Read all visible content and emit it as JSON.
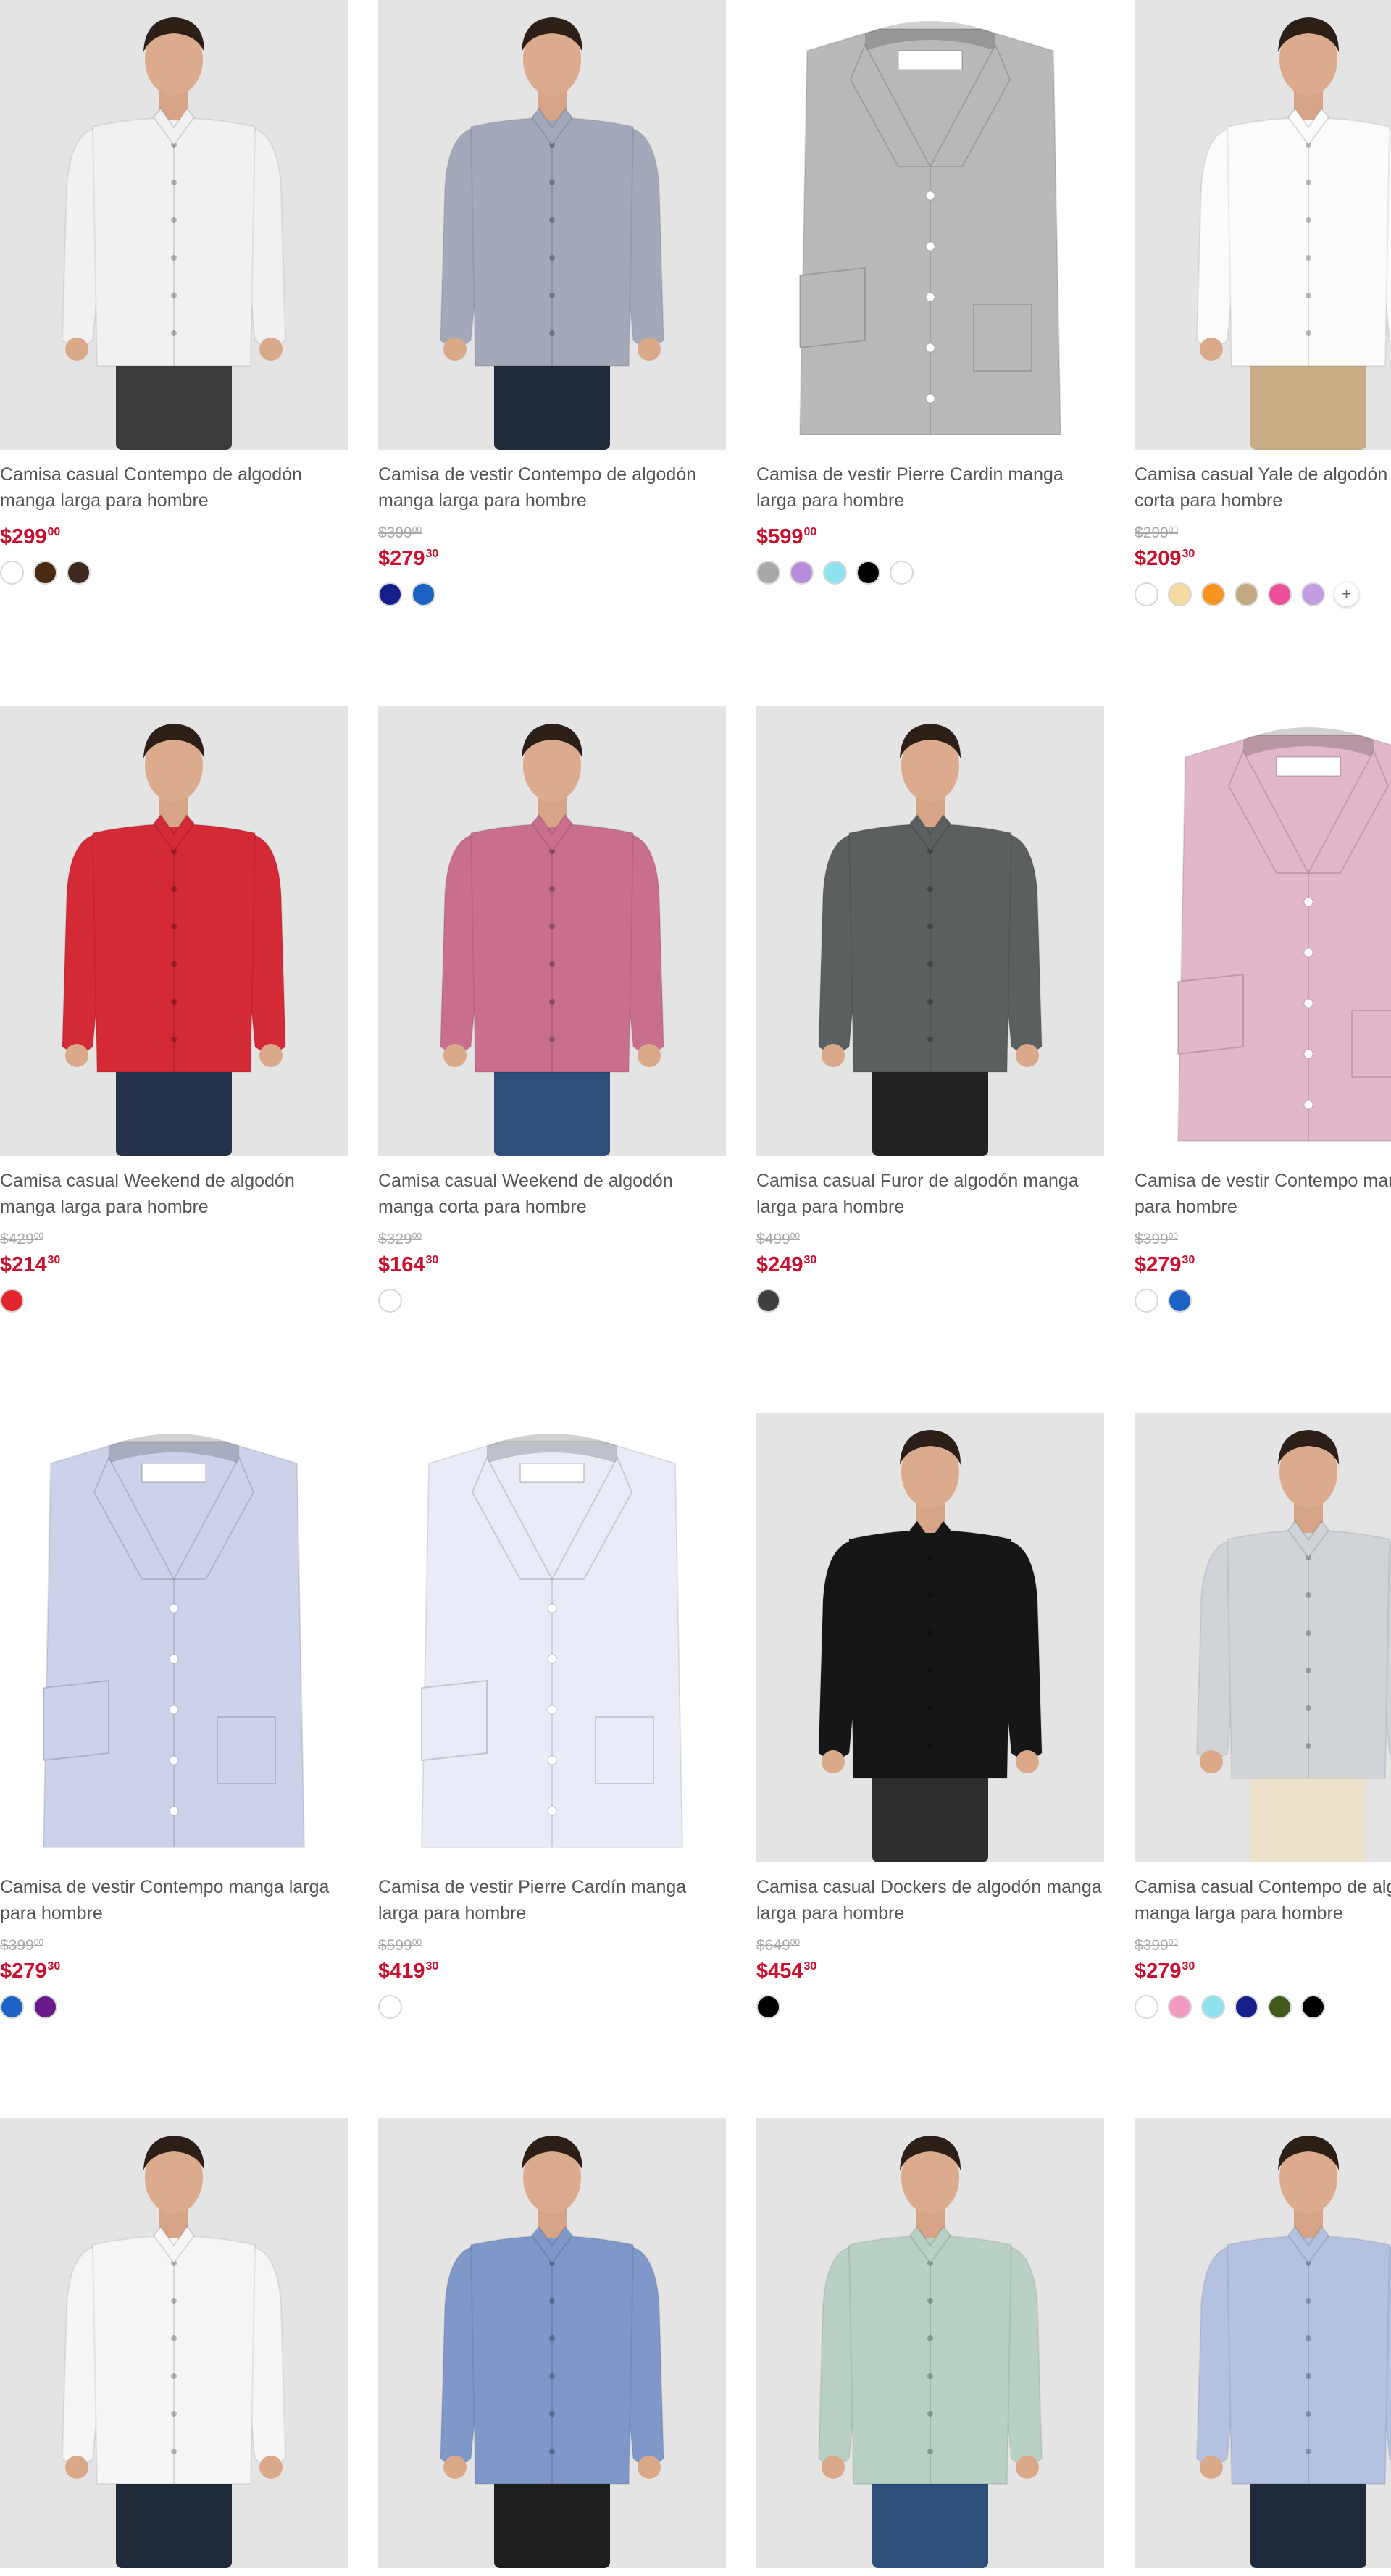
{
  "products": [
    {
      "title": "Camisa casual Contempo de algodón manga larga para hombre",
      "old_price": null,
      "price": "$299",
      "cents": "00",
      "photo": "model",
      "shirt_color": "#f1f1f1",
      "pants_color": "#3b3b3b",
      "swatches": [
        "#ffffff",
        "#4a2a10",
        "#3e2a1c"
      ],
      "more": false
    },
    {
      "title": "Camisa de vestir Contempo de algodón manga larga para hombre",
      "old_price": "$399",
      "old_cents": "00",
      "price": "$279",
      "cents": "30",
      "photo": "model",
      "shirt_color": "#a3a9ba",
      "pants_color": "#1f2a3a",
      "swatches": [
        "#151e8a",
        "#1b62c4"
      ],
      "more": false
    },
    {
      "title": "Camisa de vestir Pierre Cardin manga larga para hombre",
      "old_price": null,
      "price": "$599",
      "cents": "00",
      "photo": "folded",
      "shirt_color": "#b9b9b9",
      "pants_color": null,
      "swatches": [
        "#a8a8a8",
        "#b78cdb",
        "#8fe2ef",
        "#000000",
        "#ffffff"
      ],
      "more": false
    },
    {
      "title": "Camisa casual Yale de algodón manga corta para hombre",
      "old_price": "$299",
      "old_cents": "00",
      "price": "$209",
      "cents": "30",
      "photo": "model",
      "shirt_color": "#fbfbfb",
      "pants_color": "#c7ac86",
      "swatches": [
        "#ffffff",
        "#f4d9a0",
        "#f7931e",
        "#c4a882",
        "#ee4f9a",
        "#c39be0"
      ],
      "more": true
    },
    {
      "title": "Camisa casual Weekend de algodón manga larga para hombre",
      "old_price": "$429",
      "old_cents": "00",
      "price": "$214",
      "cents": "30",
      "photo": "model",
      "shirt_color": "#d42a36",
      "pants_color": "#26324c",
      "swatches": [
        "#e3262e"
      ],
      "more": false
    },
    {
      "title": "Camisa casual Weekend de algodón manga corta para hombre",
      "old_price": "$329",
      "old_cents": "00",
      "price": "$164",
      "cents": "30",
      "photo": "model",
      "shirt_color": "#c96f8d",
      "pants_color": "#2d4f7a",
      "swatches": [
        "#ffffff"
      ],
      "more": false
    },
    {
      "title": "Camisa casual Furor de algodón manga larga para hombre",
      "old_price": "$499",
      "old_cents": "00",
      "price": "$249",
      "cents": "30",
      "photo": "model",
      "shirt_color": "#5b5f5f",
      "pants_color": "#222222",
      "swatches": [
        "#3f3f3f"
      ],
      "more": false
    },
    {
      "title": "Camisa de vestir Contempo manga larga para hombre",
      "old_price": "$399",
      "old_cents": "00",
      "price": "$279",
      "cents": "30",
      "photo": "folded",
      "shirt_color": "#e2b7c9",
      "pants_color": null,
      "swatches": [
        "#ffffff",
        "#1b62c4"
      ],
      "more": false
    },
    {
      "title": "Camisa de vestir Contempo manga larga para hombre",
      "old_price": "$399",
      "old_cents": "00",
      "price": "$279",
      "cents": "30",
      "photo": "folded",
      "shirt_color": "#ccd2ea",
      "pants_color": null,
      "swatches": [
        "#1b62c4",
        "#6a1b8a"
      ],
      "more": false
    },
    {
      "title": "Camisa de vestir Pierre Cardín manga larga para hombre",
      "old_price": "$599",
      "old_cents": "00",
      "price": "$419",
      "cents": "30",
      "photo": "folded",
      "shirt_color": "#e9ecf6",
      "pants_color": null,
      "swatches": [
        "#ffffff"
      ],
      "more": false
    },
    {
      "title": "Camisa casual Dockers de algodón manga larga para hombre",
      "old_price": "$649",
      "old_cents": "00",
      "price": "$454",
      "cents": "30",
      "photo": "model",
      "shirt_color": "#161616",
      "pants_color": "#2e2e2e",
      "swatches": [
        "#000000"
      ],
      "more": false
    },
    {
      "title": "Camisa casual Contempo de algodón manga larga para hombre",
      "old_price": "$399",
      "old_cents": "00",
      "price": "$279",
      "cents": "30",
      "photo": "model",
      "shirt_color": "#d0d3d8",
      "pants_color": "#ece1ca",
      "swatches": [
        "#ffffff",
        "#f49ac1",
        "#8fe2ef",
        "#151e8a",
        "#3f5a1a",
        "#000000"
      ],
      "more": false
    },
    {
      "title": "",
      "old_price": null,
      "price": "",
      "cents": "",
      "photo": "model",
      "shirt_color": "#f6f6f6",
      "pants_color": "#1f2a3a",
      "swatches": [],
      "more": false
    },
    {
      "title": "",
      "old_price": null,
      "price": "",
      "cents": "",
      "photo": "model",
      "shirt_color": "#7f98c9",
      "pants_color": "#1f1f1f",
      "swatches": [],
      "more": false
    },
    {
      "title": "",
      "old_price": null,
      "price": "",
      "cents": "",
      "photo": "model",
      "shirt_color": "#b9d1c4",
      "pants_color": "#2d4f7a",
      "swatches": [],
      "more": false
    },
    {
      "title": "",
      "old_price": null,
      "price": "",
      "cents": "",
      "photo": "model",
      "shirt_color": "#b4c2e1",
      "pants_color": "#1f2a3a",
      "swatches": [],
      "more": false
    }
  ]
}
